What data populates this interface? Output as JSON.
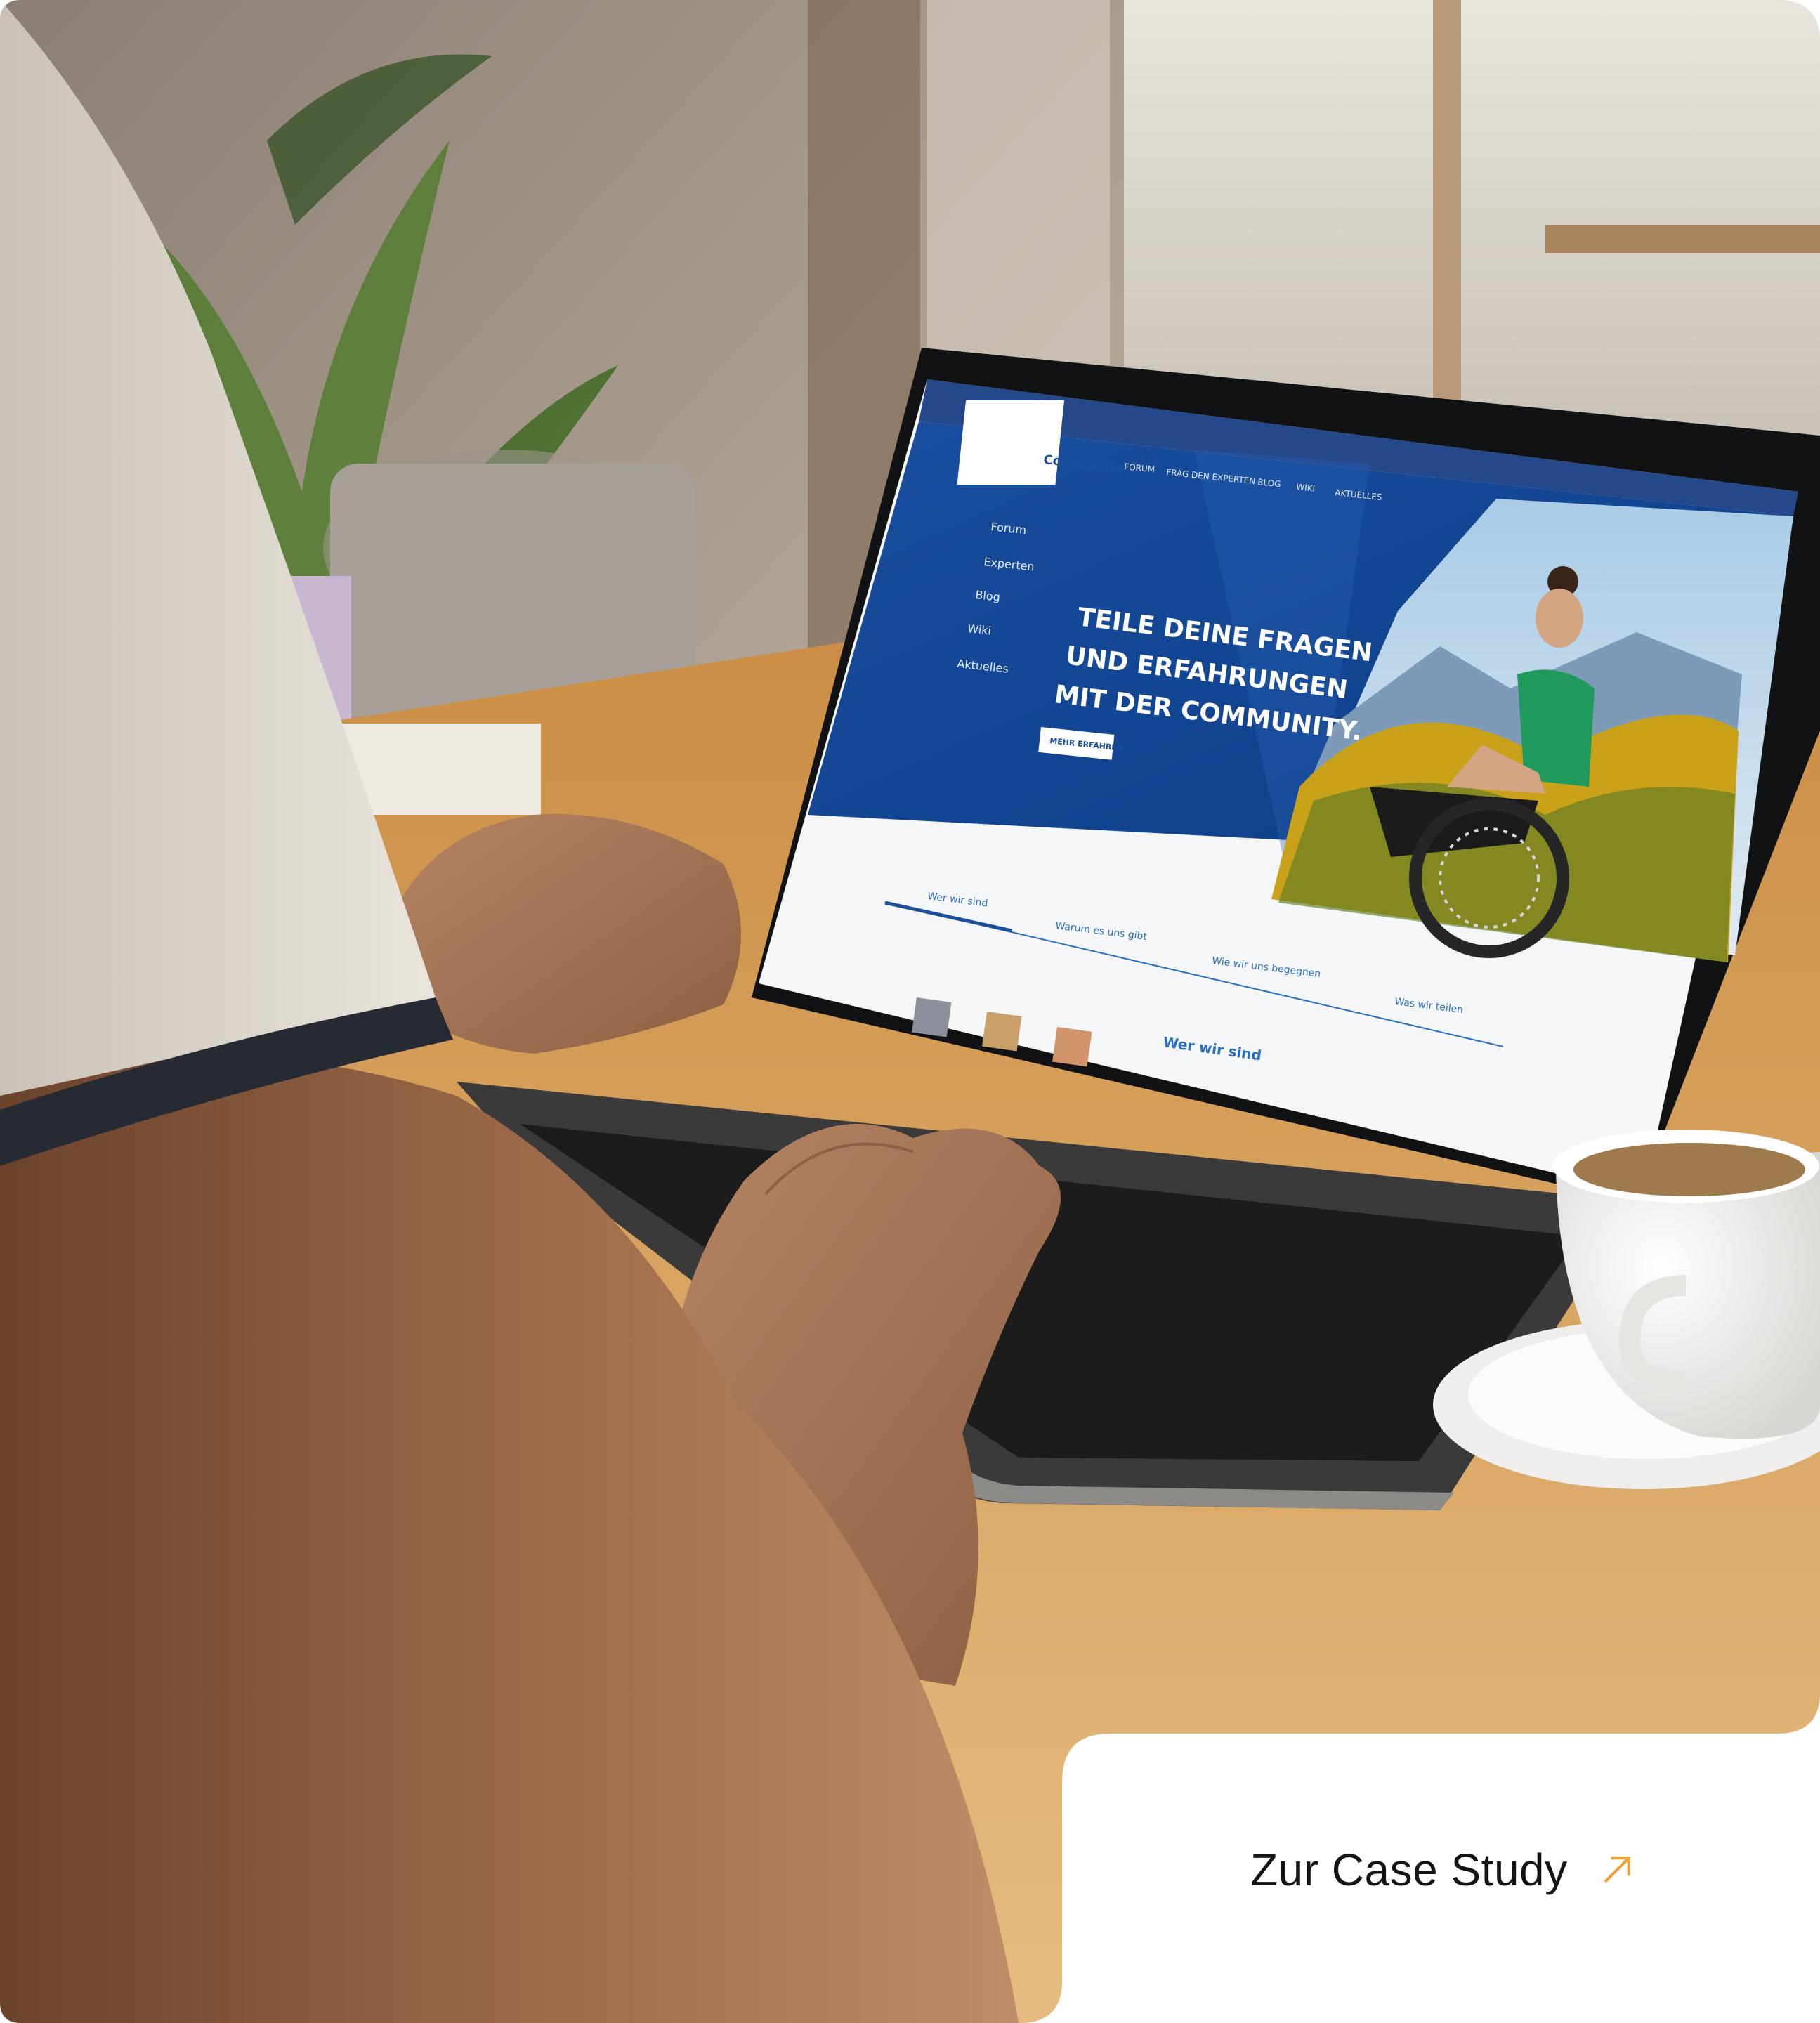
{
  "accent_color": "#f0a23a",
  "screen_blue": "#0f4a9a",
  "cta": {
    "label": "Zur Case Study",
    "icon": "arrow-up-right-icon"
  },
  "laptop_site": {
    "brand": "Community",
    "nav": [
      "FORUM",
      "FRAG DEN EXPERTEN",
      "BLOG",
      "WIKI",
      "AKTUELLES"
    ],
    "side_menu": [
      "Forum",
      "Experten",
      "Blog",
      "Wiki",
      "Aktuelles"
    ],
    "hero_lines": [
      "TEILE DEINE FRAGEN",
      "UND ERFAHRUNGEN",
      "MIT DER COMMUNITY."
    ],
    "hero_button": "MEHR ERFAHREN",
    "tabs": [
      "Wer wir sind",
      "Warum es uns gibt",
      "Wie wir uns begegnen",
      "Was wir teilen"
    ],
    "section_heading": "Wer wir sind"
  }
}
